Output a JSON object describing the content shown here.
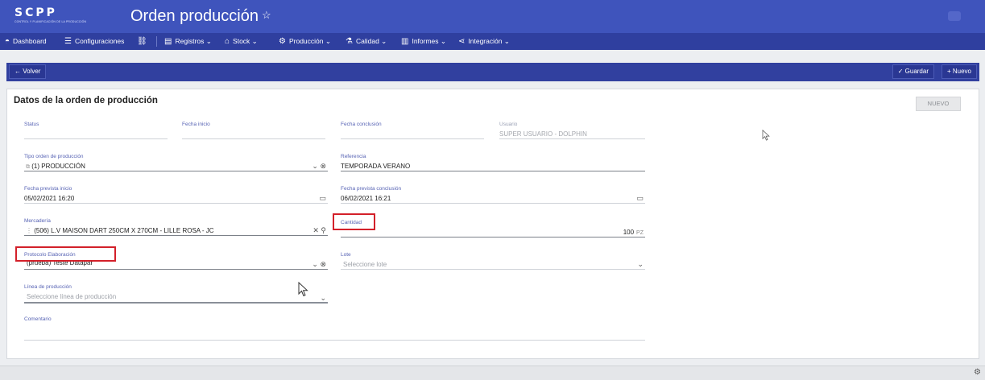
{
  "app": {
    "logo_text": "SCPP",
    "logo_subtitle": "CONTROL Y PLANIFICACIÓN DE LA PRODUCCIÓN",
    "page_title": "Orden producción"
  },
  "menu": {
    "dashboard": "Dashboard",
    "configuraciones": "Configuraciones",
    "registros": "Registros ⌄",
    "stock": "Stock ⌄",
    "produccion": "Producción ⌄",
    "calidad": "Calidad ⌄",
    "informes": "Informes ⌄",
    "integracion": "Integración ⌄"
  },
  "actions": {
    "back": "Volver",
    "save": "Guardar",
    "new": "Nuevo"
  },
  "card": {
    "title": "Datos de la orden de producción",
    "status_badge": "NUEVO"
  },
  "fields": {
    "status": {
      "label": "Status",
      "value": ""
    },
    "fecha_inicio": {
      "label": "Fecha inicio",
      "value": ""
    },
    "fecha_conclusion": {
      "label": "Fecha conclusión",
      "value": ""
    },
    "usuario": {
      "label": "Usuario",
      "value": "SUPER USUARIO - DOLPHIN"
    },
    "tipo_orden": {
      "label": "Tipo orden de producción",
      "value": "(1) PRODUCCIÓN"
    },
    "referencia": {
      "label": "Referencia",
      "value": "TEMPORADA VERANO"
    },
    "fecha_prevista_inicio": {
      "label": "Fecha prevista inicio",
      "value": "05/02/2021 16:20"
    },
    "fecha_prevista_conclusion": {
      "label": "Fecha prevista conclusión",
      "value": "06/02/2021 16:21"
    },
    "mercaderia": {
      "label": "Mercadería",
      "value": "(506) L.V MAISON DART 250CM X 270CM - LILLE ROSA - JC"
    },
    "cantidad": {
      "label": "Cantidad",
      "value": "100",
      "unit": "PZ"
    },
    "protocolo": {
      "label": "Protocolo Elaboración",
      "value": "(prueba) Teste Datapar"
    },
    "lote": {
      "label": "Lote",
      "placeholder": "Seleccione lote"
    },
    "linea": {
      "label": "Línea de producción",
      "placeholder": "Seleccione línea de producción"
    },
    "comentario": {
      "label": "Comentario",
      "value": ""
    }
  },
  "colors": {
    "header": "#3f54bc",
    "menubar": "#2f3f9f",
    "actionbar": "#31409f",
    "label": "#5763b4",
    "highlight": "#d3202a"
  }
}
